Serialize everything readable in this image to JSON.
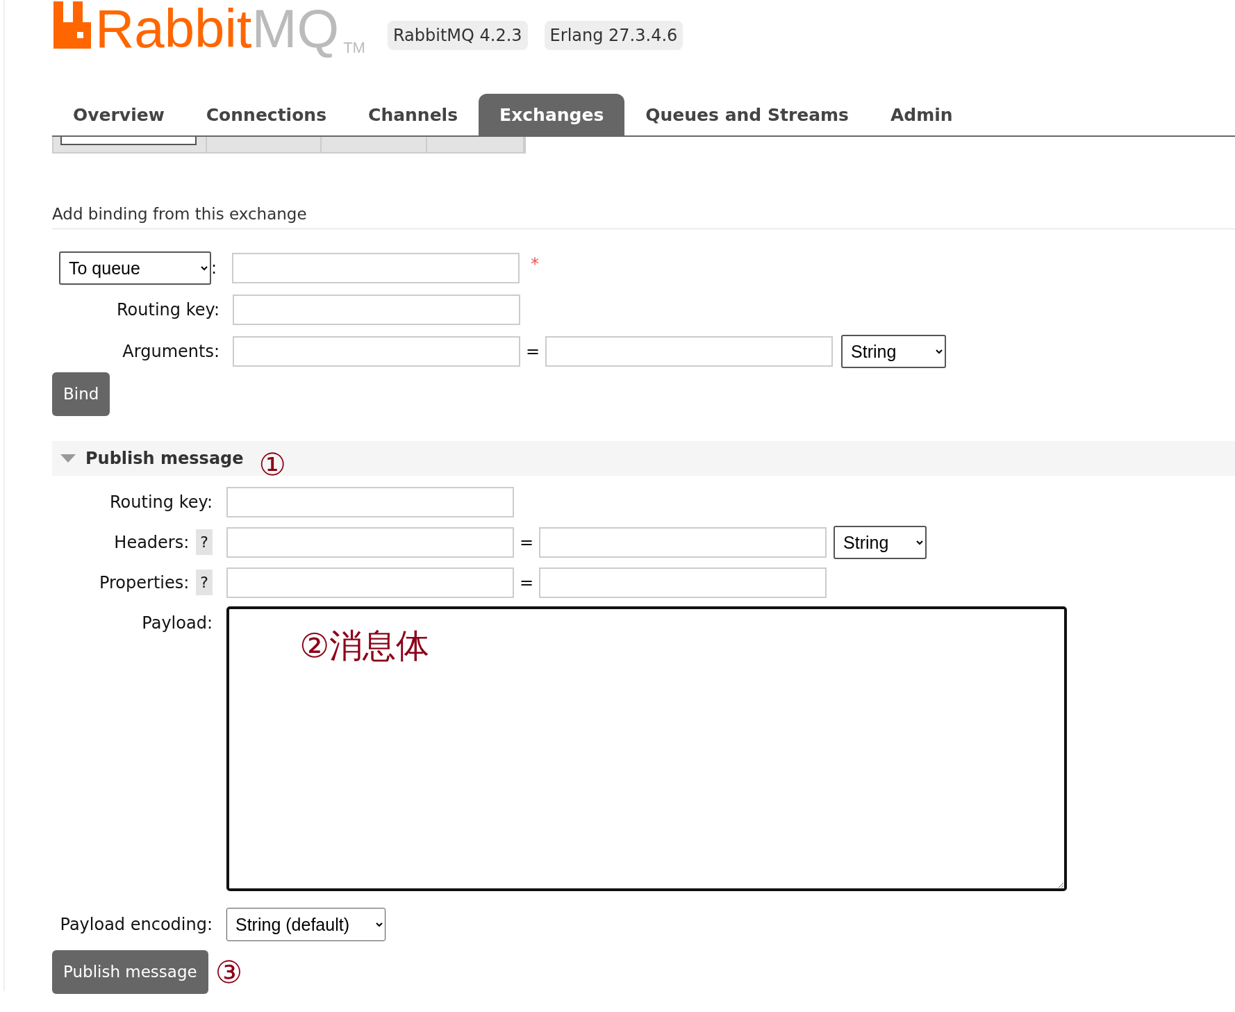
{
  "header": {
    "logo": {
      "brand": "Rabbit",
      "suffix": "MQ",
      "trademark": "TM"
    },
    "badges": [
      "RabbitMQ 4.2.3",
      "Erlang 27.3.4.6"
    ]
  },
  "tabs": [
    {
      "label": "Overview",
      "selected": false
    },
    {
      "label": "Connections",
      "selected": false
    },
    {
      "label": "Channels",
      "selected": false
    },
    {
      "label": "Exchanges",
      "selected": true
    },
    {
      "label": "Queues and Streams",
      "selected": false
    },
    {
      "label": "Admin",
      "selected": false
    }
  ],
  "binding": {
    "title": "Add binding from this exchange",
    "destination": "To queue",
    "colon": ":",
    "required_mark": "*",
    "routing_key_label": "Routing key:",
    "arguments_label": "Arguments:",
    "equals": "=",
    "argument_type": "String",
    "button": "Bind"
  },
  "publish": {
    "title": "Publish message",
    "expanded": true,
    "annotation": "①",
    "routing_key_label": "Routing key:",
    "headers": {
      "label": "Headers:",
      "help": "?",
      "equals": "=",
      "type": "String"
    },
    "properties": {
      "label": "Properties:",
      "help": "?",
      "equals": "="
    },
    "payload_label": "Payload:",
    "payload_annotation": "②消息体",
    "encoding_label": "Payload encoding:",
    "encoding": "String (default)",
    "button": "Publish message",
    "button_annotation": "③"
  }
}
